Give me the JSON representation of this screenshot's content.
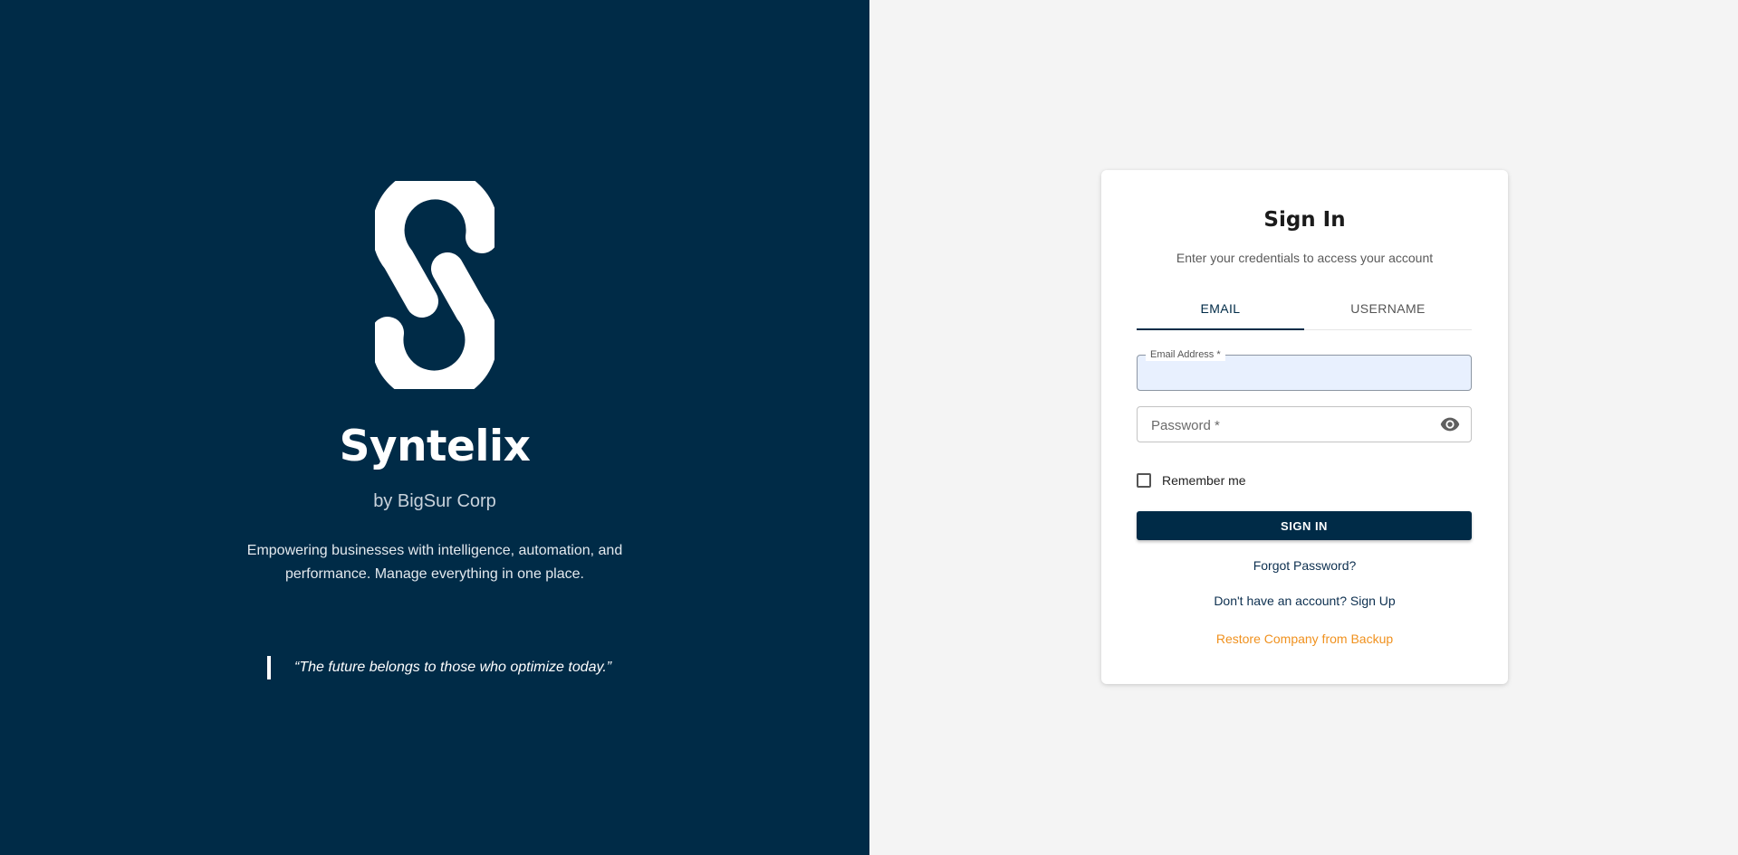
{
  "brand": {
    "name": "Syntelix",
    "byline": "by BigSur Corp",
    "description": "Empowering businesses with intelligence, automation, and performance. Manage everything in one place.",
    "quote": "“The future belongs to those who optimize today.”",
    "logo_icon": "s-link-logo-icon",
    "background_color": "#002b47"
  },
  "signin": {
    "title": "Sign In",
    "subtitle": "Enter your credentials to access your account",
    "tabs": [
      {
        "label": "EMAIL",
        "active": true
      },
      {
        "label": "USERNAME",
        "active": false
      }
    ],
    "email_label": "Email Address *",
    "email_value": "",
    "password_placeholder": "Password *",
    "password_value": "",
    "toggle_visibility_icon": "eye-icon",
    "remember_label": "Remember me",
    "remember_checked": false,
    "button_label": "SIGN IN",
    "forgot_label": "Forgot Password?",
    "signup_label": "Don't have an account? Sign Up",
    "restore_label": "Restore Company from Backup",
    "accent_color": "#002b47",
    "restore_color": "#f0911e"
  }
}
